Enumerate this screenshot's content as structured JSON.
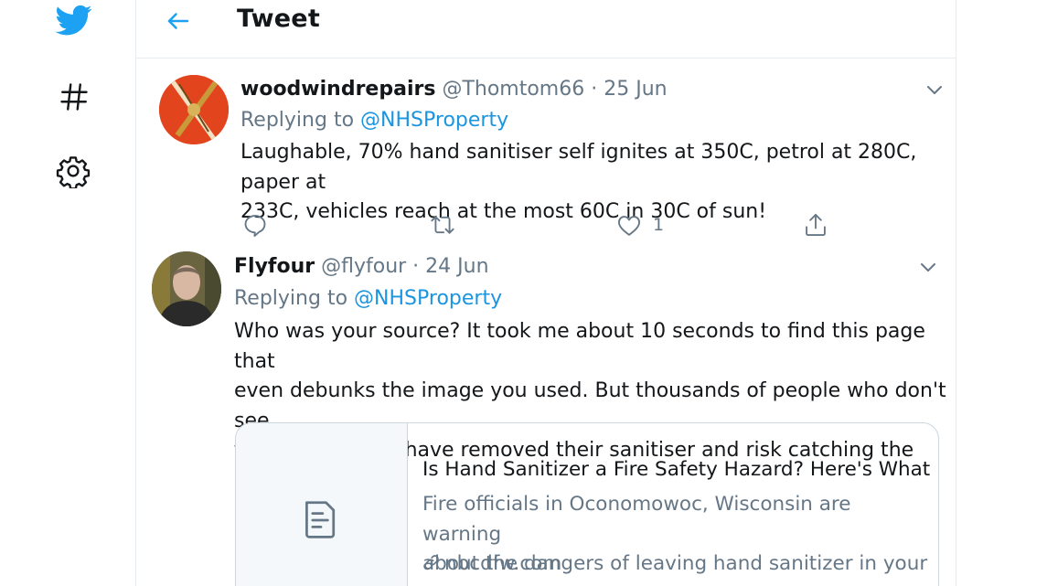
{
  "header": {
    "title": "Tweet"
  },
  "tweets": [
    {
      "name": "woodwindrepairs",
      "handle": "@Thomtom66",
      "sep": " · ",
      "date": "25 Jun",
      "replying_prefix": "Replying to ",
      "replying_to": "@NHSProperty",
      "body_lines": [
        "Laughable, 70% hand sanitiser self ignites at 350C, petrol at 280C, paper at",
        "233C, vehicles reach at the most 60C in 30C of sun!"
      ],
      "like_count": "1"
    },
    {
      "name": "Flyfour",
      "handle": "@flyfour",
      "sep": " · ",
      "date": "24 Jun",
      "replying_prefix": "Replying to ",
      "replying_to": "@NHSProperty",
      "body_lines": [
        "Who was your source? It took me about 10 seconds to find this page that",
        "even debunks the image you used. But thousands of people who don't see",
        "this update may have removed their sanitiser and risk catching the disease!"
      ]
    }
  ],
  "card": {
    "title": "Is Hand Sanitizer a Fire Safety Hazard? Here's What E...",
    "desc_lines": [
      "Fire officials in Oconomowoc, Wisconsin are warning",
      "about the dangers of leaving hand sanitizer in your c..."
    ],
    "domain": "nbcdfw.com"
  },
  "colors": {
    "accent": "#1da1f2",
    "link": "#1b95e0",
    "secondary_text": "#657786",
    "divider": "#e6ecf0"
  },
  "icons": {
    "nav": [
      "twitter-logo-icon",
      "hashtag-icon",
      "gear-icon"
    ],
    "header": "back-arrow-icon",
    "tweet_actions": [
      "reply-icon",
      "retweet-icon",
      "like-icon",
      "share-icon"
    ],
    "caret": "chevron-down-icon",
    "card": [
      "document-icon",
      "link-icon"
    ]
  }
}
